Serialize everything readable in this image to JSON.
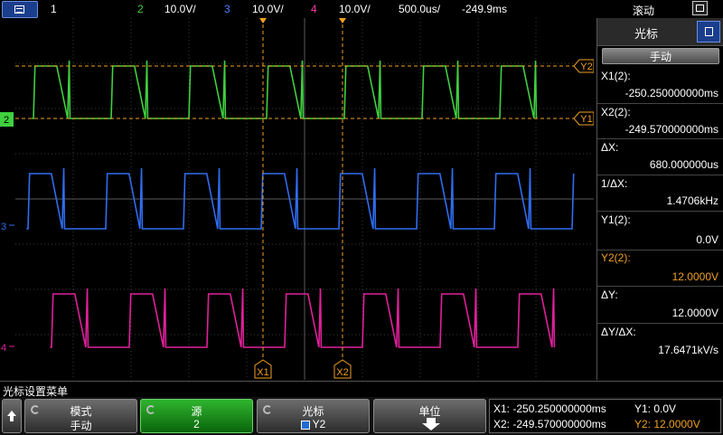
{
  "topbar": {
    "ch1_label": "1",
    "ch2_label": "2",
    "ch2_scale": "10.0V/",
    "ch3_label": "3",
    "ch3_scale": "10.0V/",
    "ch4_label": "4",
    "ch4_scale": "10.0V/",
    "timebase": "500.0us/",
    "delay": "-249.9ms",
    "mode": "滚动"
  },
  "colors": {
    "ch2": "#3fd03f",
    "ch3": "#2f6df0",
    "ch4": "#e0209a",
    "cursor": "#f0a020",
    "ch1": "#f5e32a"
  },
  "markers": {
    "ch2": "2",
    "ch3": "3",
    "ch4": "4",
    "x1": "X1",
    "x2": "X2",
    "y1": "Y1",
    "y2": "Y2"
  },
  "panel": {
    "title": "光标",
    "mode_value": "手动",
    "x1_label": "X1(2):",
    "x1_value": "-250.250000000ms",
    "x2_label": "X2(2):",
    "x2_value": "-249.570000000ms",
    "dx_label": "ΔX:",
    "dx_value": "680.000000us",
    "inv_dx_label": "1/ΔX:",
    "inv_dx_value": "1.4706kHz",
    "y1_label": "Y1(2):",
    "y1_value": "0.0V",
    "y2_label": "Y2(2):",
    "y2_value": "12.0000V",
    "dy_label": "ΔY:",
    "dy_value": "12.0000V",
    "dydx_label": "ΔY/ΔX:",
    "dydx_value": "17.6471kV/s"
  },
  "statusbar": {
    "text": "光标设置菜单"
  },
  "softkeys": {
    "mode_title": "模式",
    "mode_value": "手动",
    "source_title": "源",
    "source_value": "2",
    "cursor_title": "光标",
    "cursor_value": "Y2",
    "unit_title": "单位"
  },
  "readout": {
    "x1": "X1:  -250.250000000ms",
    "x2": "X2:  -249.570000000ms",
    "y1": "Y1: 0.0V",
    "y2": "Y2: 12.0000V"
  }
}
